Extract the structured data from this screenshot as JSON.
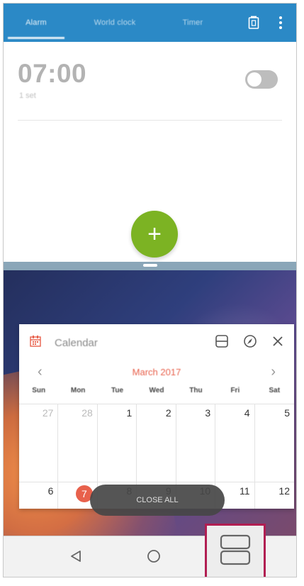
{
  "top_app": {
    "tabs": [
      {
        "label": "Alarm"
      },
      {
        "label": "World clock"
      },
      {
        "label": "Timer"
      }
    ],
    "icons": [
      "delete-icon",
      "more-vert-icon"
    ]
  },
  "alarm": {
    "time": "07:00",
    "sub": "1 set",
    "toggle_state": "off",
    "add_symbol": "+"
  },
  "calendar_widget": {
    "title": "Calendar",
    "month_label": "March 2017",
    "prev_symbol": "‹",
    "next_symbol": "›",
    "weekdays": [
      "Sun",
      "Mon",
      "Tue",
      "Wed",
      "Thu",
      "Fri",
      "Sat"
    ],
    "week1": [
      "27",
      "28",
      "1",
      "2",
      "3",
      "4",
      "5"
    ],
    "week2": [
      "6",
      "7",
      "8",
      "9",
      "10",
      "11",
      "12"
    ],
    "today": "7",
    "header_icons": [
      "split-window-icon",
      "compass-icon",
      "close-icon"
    ],
    "toast": "CLOSE ALL"
  },
  "colors": {
    "header_blue": "#2b89c6",
    "fab_green": "#7cb323",
    "accent_red": "#e8614c",
    "highlight_magenta": "#b11e52"
  },
  "navbar": {
    "icons": [
      "back-icon",
      "home-icon",
      "recent-apps-split-icon"
    ]
  }
}
